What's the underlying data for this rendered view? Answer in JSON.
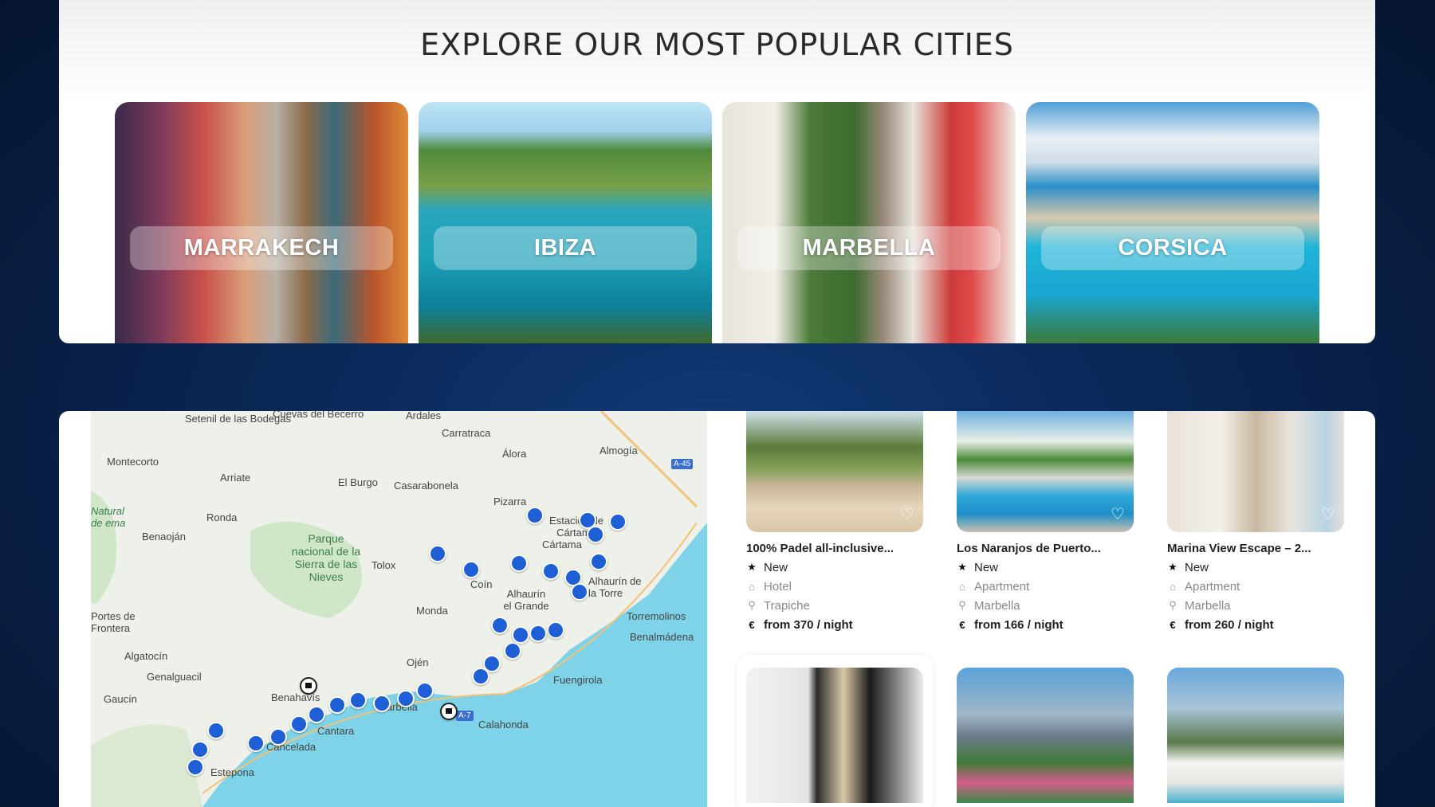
{
  "cities": {
    "title": "EXPLORE OUR MOST POPULAR CITIES",
    "items": [
      {
        "name": "MARRAKECH"
      },
      {
        "name": "IBIZA"
      },
      {
        "name": "MARBELLA"
      },
      {
        "name": "CORSICA"
      }
    ]
  },
  "map": {
    "labels": [
      "Setenil de las Bodegas",
      "Cuevas del Becerro",
      "Ardales",
      "Carratraca",
      "Álora",
      "Almogía",
      "A-45",
      "Montecorto",
      "Arriate",
      "El Burgo",
      "Casarabonela",
      "Pizarra",
      "Natural de ema",
      "Ronda",
      "Estación de Cártama",
      "Cártama",
      "Benaoján",
      "Parque nacional de la Sierra de las Nieves",
      "Tolox",
      "Coín",
      "Alhaurín de la Torre",
      "Alhaurín el Grande",
      "Torremolinos",
      "Portes de Frontera",
      "Monda",
      "Benalmádena",
      "Algatocín",
      "Ojén",
      "Fuengirola",
      "Genalguacil",
      "Benahavís",
      "Marbella",
      "Gaucín",
      "Cantara",
      "A-7",
      "Calahonda",
      "Cancelada",
      "Estepona"
    ]
  },
  "listings": [
    {
      "title": "100% Padel all-inclusive...",
      "badge": "New",
      "type": "Hotel",
      "location": "Trapiche",
      "price": "from 370 / night"
    },
    {
      "title": "Los Naranjos de Puerto...",
      "badge": "New",
      "type": "Apartment",
      "location": "Marbella",
      "price": "from 166 / night"
    },
    {
      "title": "Marina View Escape – 2...",
      "badge": "New",
      "type": "Apartment",
      "location": "Marbella",
      "price": "from 260 / night"
    }
  ],
  "icons": {
    "star": "star-icon",
    "building": "building-icon",
    "pin": "location-pin-icon",
    "euro": "euro-icon",
    "heart": "heart-icon"
  },
  "colors": {
    "pin": "#1f5fd6",
    "background": "#0b2a5c"
  }
}
